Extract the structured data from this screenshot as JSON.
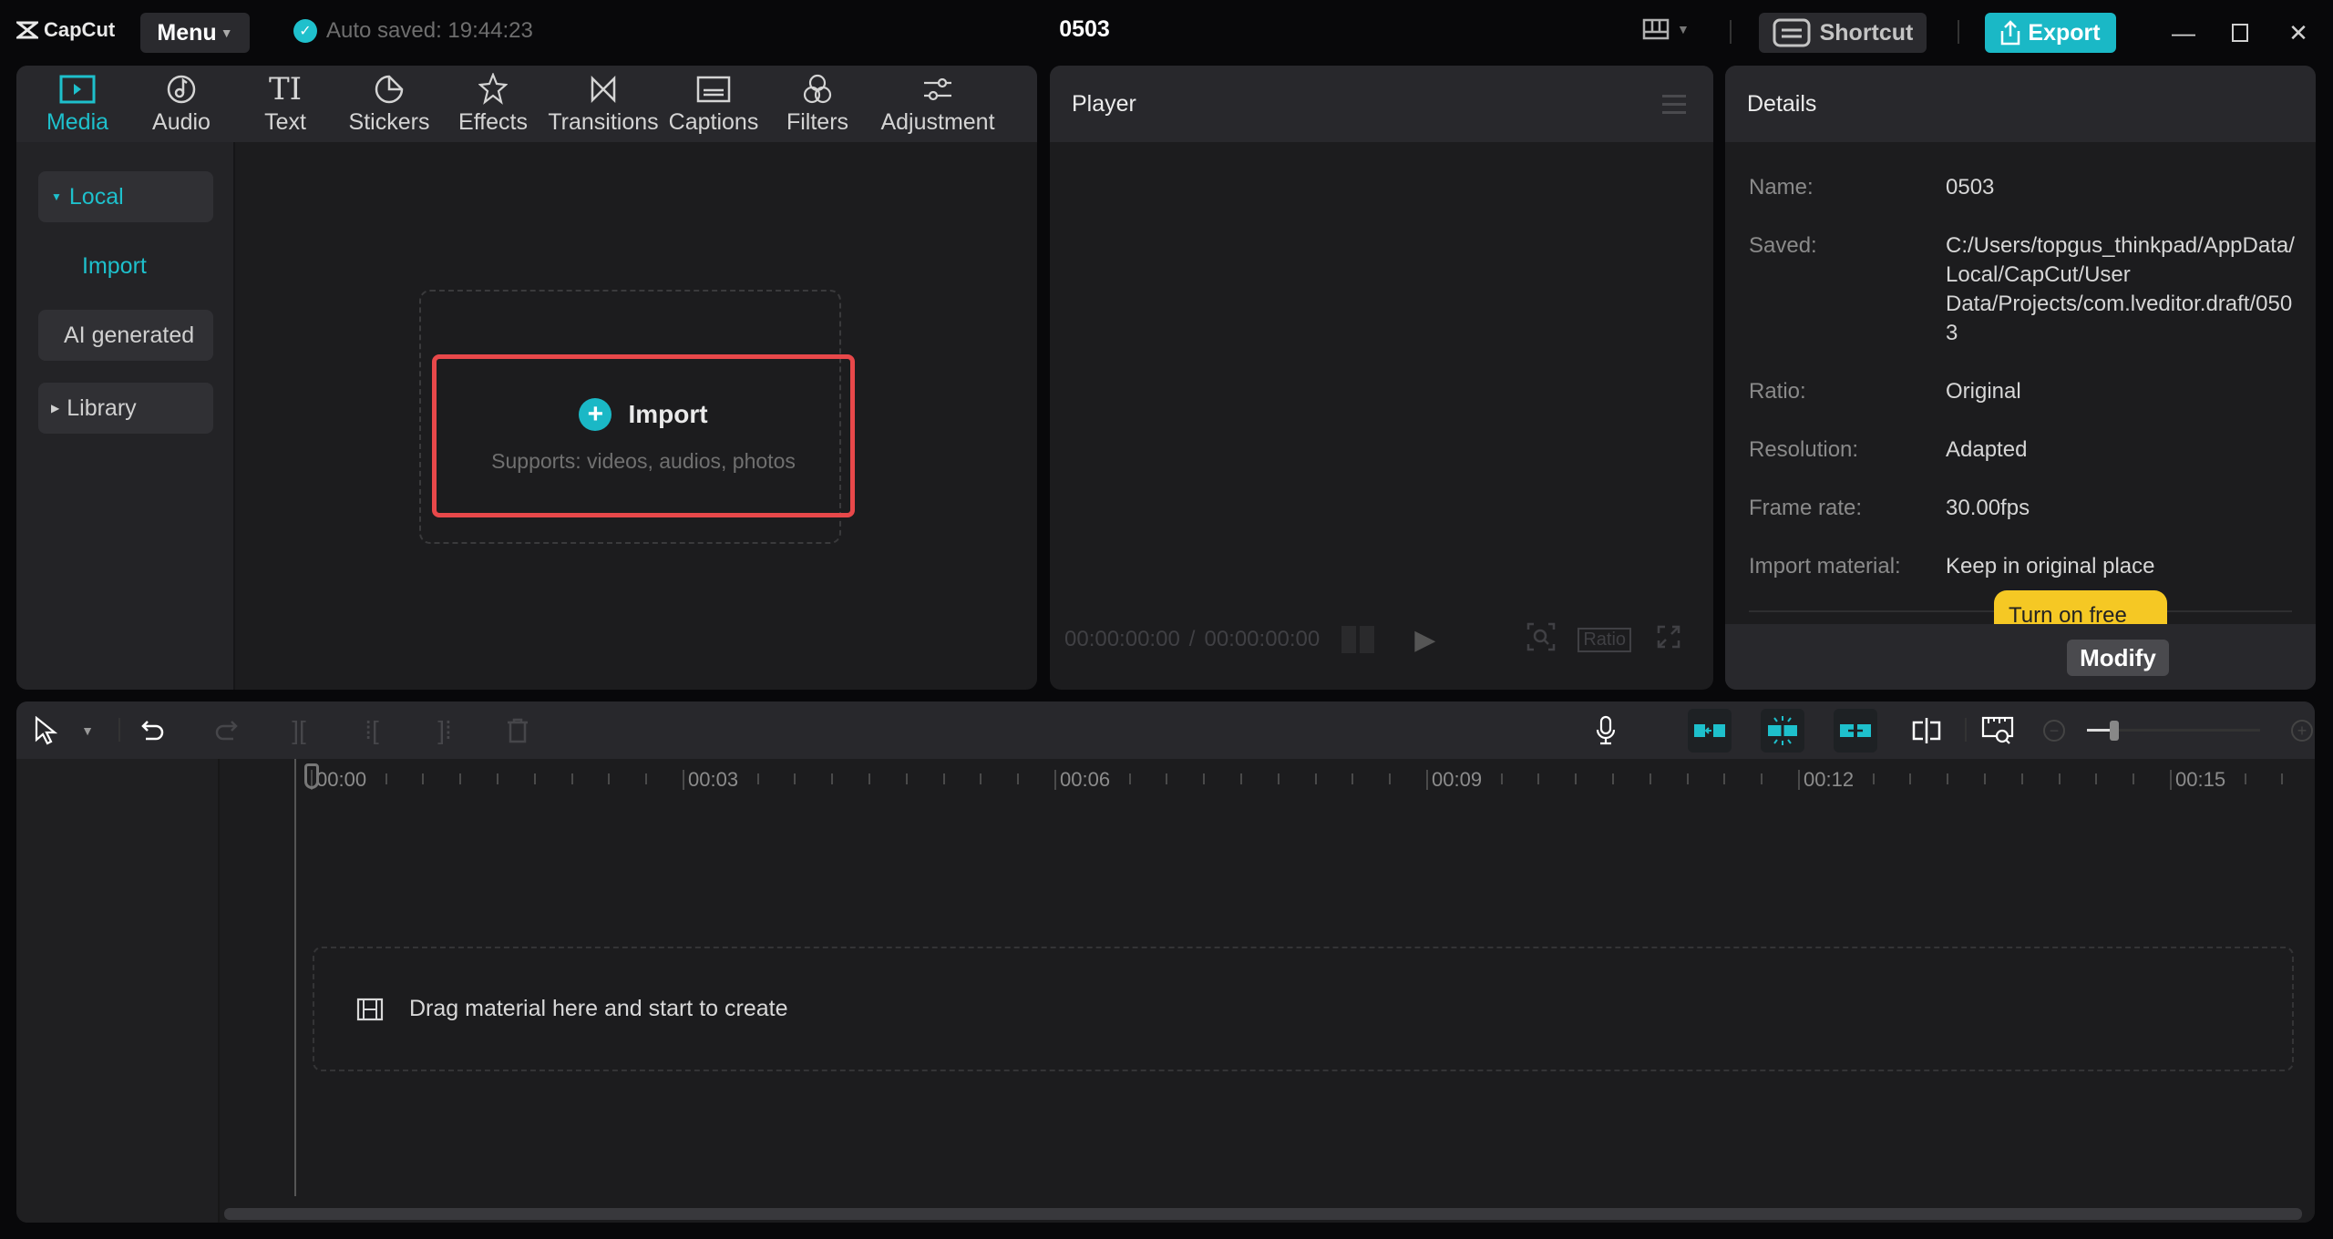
{
  "app": {
    "name": "CapCut",
    "menu_label": "Menu",
    "autosave_text": "Auto saved: 19:44:23",
    "project_title": "0503",
    "shortcut_label": "Shortcut",
    "export_label": "Export",
    "accent_color": "#1ec0cc"
  },
  "media": {
    "tabs": [
      {
        "label": "Media",
        "icon": "media-icon",
        "active": true
      },
      {
        "label": "Audio",
        "icon": "audio-icon"
      },
      {
        "label": "Text",
        "icon": "text-icon"
      },
      {
        "label": "Stickers",
        "icon": "stickers-icon"
      },
      {
        "label": "Effects",
        "icon": "effects-icon"
      },
      {
        "label": "Transitions",
        "icon": "transitions-icon"
      },
      {
        "label": "Captions",
        "icon": "captions-icon"
      },
      {
        "label": "Filters",
        "icon": "filters-icon"
      },
      {
        "label": "Adjustment",
        "icon": "adjustment-icon"
      }
    ],
    "sidebar": {
      "local": "Local",
      "import": "Import",
      "ai_generated": "AI generated",
      "library": "Library"
    },
    "import_box": {
      "title": "Import",
      "subtitle": "Supports: videos, audios, photos"
    }
  },
  "player": {
    "title": "Player",
    "current_time": "00:00:00:00",
    "separator": "/",
    "total_time": "00:00:00:00",
    "ratio_label": "Ratio"
  },
  "details": {
    "title": "Details",
    "rows": [
      {
        "label": "Name:",
        "value": "0503"
      },
      {
        "label": "Saved:",
        "value": "C:/Users/topgus_thinkpad/AppData/Local/CapCut/User Data/Projects/com.lveditor.draft/0503"
      },
      {
        "label": "Ratio:",
        "value": "Original"
      },
      {
        "label": "Resolution:",
        "value": "Adapted"
      },
      {
        "label": "Frame rate:",
        "value": "30.00fps"
      },
      {
        "label": "Import material:",
        "value": "Keep in original place"
      }
    ],
    "tooltip": "Turn on free layer",
    "modify_label": "Modify"
  },
  "timeline": {
    "ruler_labels": [
      "00:00",
      "00:03",
      "00:06",
      "00:09",
      "00:12",
      "00:15"
    ],
    "drag_hint": "Drag material here and start to create",
    "zoom_level": 0.1
  }
}
